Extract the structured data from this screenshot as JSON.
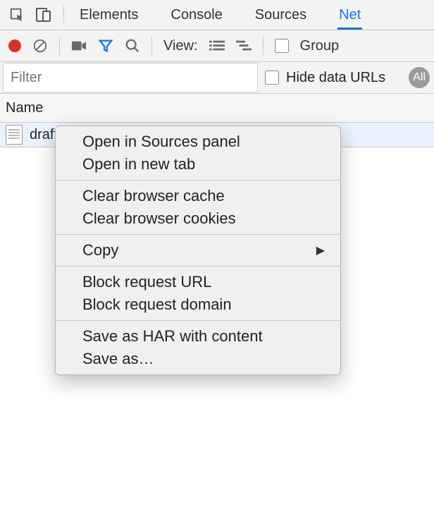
{
  "topbar": {
    "tabs": [
      "Elements",
      "Console",
      "Sources",
      "Net"
    ]
  },
  "toolbar": {
    "view_label": "View:",
    "group_label": "Group"
  },
  "filter": {
    "placeholder": "Filter",
    "hide_data_urls": "Hide data URLs",
    "all_badge": "All"
  },
  "columns": {
    "name": "Name"
  },
  "requests": [
    {
      "filename": "draft-yasskin-wpack-bundled-exchanges.html"
    }
  ],
  "context_menu": {
    "open_in_sources": "Open in Sources panel",
    "open_in_new_tab": "Open in new tab",
    "clear_cache": "Clear browser cache",
    "clear_cookies": "Clear browser cookies",
    "copy": "Copy",
    "block_url": "Block request URL",
    "block_domain": "Block request domain",
    "save_har": "Save as HAR with content",
    "save_as": "Save as…"
  }
}
